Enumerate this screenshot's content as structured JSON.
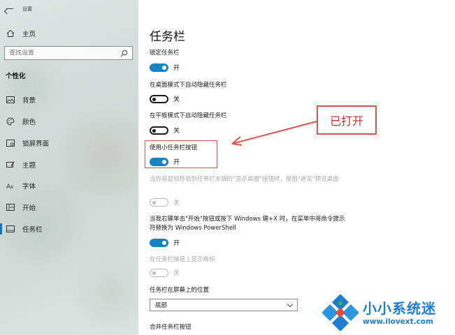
{
  "window": {
    "title": "设置"
  },
  "sidebar": {
    "home_label": "主页",
    "search_placeholder": "查找设置",
    "section_label": "个性化",
    "items": [
      {
        "label": "背景",
        "icon": "image-icon"
      },
      {
        "label": "颜色",
        "icon": "palette-icon"
      },
      {
        "label": "锁屏界面",
        "icon": "lock-screen-icon"
      },
      {
        "label": "主题",
        "icon": "theme-brush-icon"
      },
      {
        "label": "字体",
        "icon": "font-icon"
      },
      {
        "label": "开始",
        "icon": "start-grid-icon"
      },
      {
        "label": "任务栏",
        "icon": "taskbar-icon",
        "active": true
      }
    ]
  },
  "main": {
    "title": "任务栏",
    "settings": [
      {
        "label": "锁定任务栏",
        "state": "开",
        "on": true,
        "enabled": true
      },
      {
        "label": "在桌面模式下自动隐藏任务栏",
        "state": "关",
        "on": false,
        "enabled": true
      },
      {
        "label": "在平板模式下自动隐藏任务栏",
        "state": "关",
        "on": false,
        "enabled": true
      },
      {
        "label": "使用小任务栏按钮",
        "state": "开",
        "on": true,
        "enabled": true
      },
      {
        "label": "当你将鼠标移动到任务栏末端的\"显示桌面\"按钮时，使用\"速览\"预览桌面",
        "state": "关",
        "on": false,
        "enabled": false
      },
      {
        "label": "当我右键单击\"开始\"按钮或按下 Windows 键+X 时，在菜单中将命令提示符替换为 Windows PowerShell",
        "state": "开",
        "on": true,
        "enabled": true
      },
      {
        "label": "在任务栏按钮上显示角标",
        "state": "关",
        "on": false,
        "enabled": false
      }
    ],
    "position_label": "任务栏在屏幕上的位置",
    "position_value": "底部",
    "combine_label": "合并任务栏按钮"
  },
  "annotation": {
    "callout_text": "已打开",
    "color": "#d9534f"
  },
  "watermark": {
    "brand": "小小系统迷",
    "url": "www.ilovext.com"
  },
  "colors": {
    "toggle_on": "#1583c4",
    "accent": "#1a73b8",
    "brand": "#1e7fd1"
  }
}
